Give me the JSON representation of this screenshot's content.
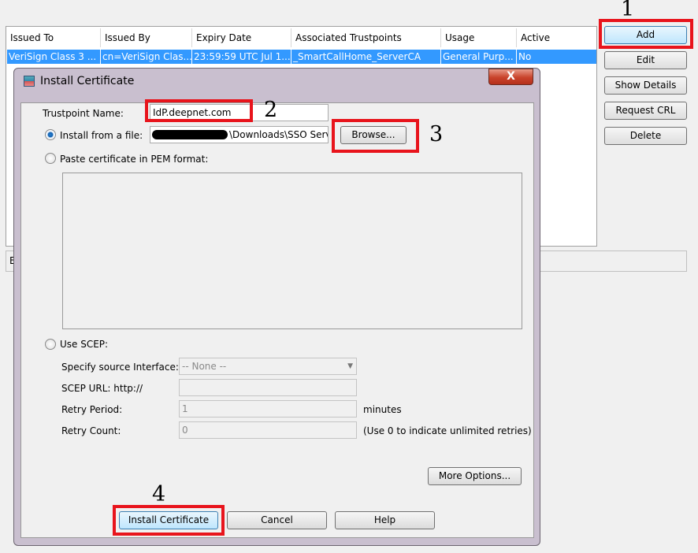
{
  "table": {
    "headers": [
      "Issued To",
      "Issued By",
      "Expiry Date",
      "Associated Trustpoints",
      "Usage",
      "Active"
    ],
    "rows": [
      [
        "VeriSign Class 3 ...",
        "cn=VeriSign Clas...",
        "23:59:59 UTC Jul 1...",
        "_SmartCallHome_ServerCA",
        "General Purp...",
        "No"
      ]
    ]
  },
  "side_buttons": {
    "add": "Add",
    "edit": "Edit",
    "show_details": "Show Details",
    "request_crl": "Request CRL",
    "delete": "Delete"
  },
  "bottom_bar_text": "E",
  "annotations": {
    "n1": "1",
    "n2": "2",
    "n3": "3",
    "n4": "4"
  },
  "dialog": {
    "title": "Install Certificate",
    "close": "X",
    "trustpoint_label": "Trustpoint Name:",
    "trustpoint_value": "IdP.deepnet.com",
    "install_file_label": "Install from a file:",
    "file_path": "\\Downloads\\SSO Serv",
    "browse": "Browse...",
    "paste_label": "Paste certificate in PEM format:",
    "scep_label": "Use SCEP:",
    "source_iface_label": "Specify source Interface:",
    "source_iface_value": "-- None --",
    "scep_url_label": "SCEP URL: http://",
    "retry_period_label": "Retry Period:",
    "retry_period_value": "1",
    "retry_period_unit": "minutes",
    "retry_count_label": "Retry Count:",
    "retry_count_value": "0",
    "retry_count_hint": "(Use 0 to indicate unlimited retries)",
    "more_options": "More Options...",
    "install": "Install Certificate",
    "cancel": "Cancel",
    "help": "Help"
  }
}
